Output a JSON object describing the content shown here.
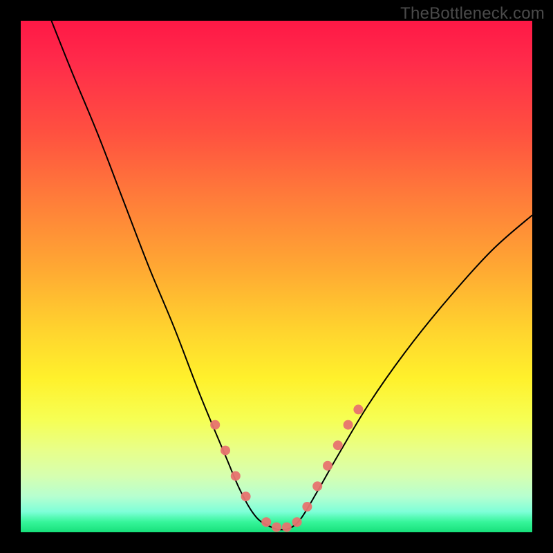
{
  "watermark": "TheBottleneck.com",
  "chart_data": {
    "type": "line",
    "title": "",
    "xlabel": "",
    "ylabel": "",
    "xlim": [
      0,
      100
    ],
    "ylim": [
      0,
      100
    ],
    "grid": false,
    "legend": false,
    "background_gradient": [
      "#ff1846",
      "#ffa733",
      "#fff12c",
      "#17e07a"
    ],
    "series": [
      {
        "name": "bottleneck-curve",
        "x": [
          6,
          10,
          15,
          20,
          25,
          30,
          35,
          40,
          43,
          46,
          49,
          51,
          53,
          55,
          58,
          62,
          68,
          75,
          83,
          92,
          100
        ],
        "y": [
          100,
          90,
          78,
          65,
          52,
          40,
          27,
          15,
          8,
          3,
          1,
          0.5,
          1,
          3,
          8,
          15,
          25,
          35,
          45,
          55,
          62
        ],
        "stroke": "#000000",
        "stroke_width": 2
      }
    ],
    "scatter": [
      {
        "name": "highlight-points",
        "x": [
          38,
          40,
          42,
          44,
          48,
          50,
          52,
          54,
          56,
          58,
          60,
          62,
          64,
          66
        ],
        "y": [
          21,
          16,
          11,
          7,
          2,
          1,
          1,
          2,
          5,
          9,
          13,
          17,
          21,
          24
        ],
        "color": "#e7736f",
        "radius": 7
      }
    ]
  }
}
